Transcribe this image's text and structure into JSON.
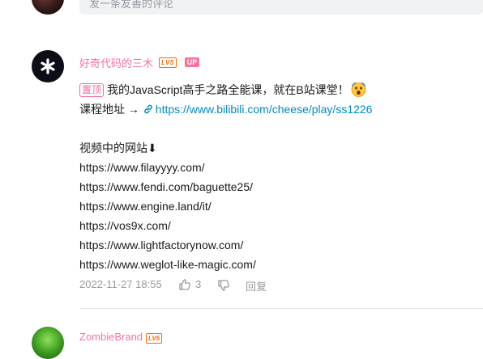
{
  "reply_box": {
    "placeholder": "发一条友善的评论"
  },
  "comment": {
    "username": "好奇代码的三木",
    "level_badge": "LV5",
    "up_badge": "UP",
    "pinned_label": "置顶",
    "line1_text": "我的JavaScript高手之路全能课，就在B站课堂！",
    "line2_label": "课程地址 →",
    "course_link": "https://www.bilibili.com/cheese/play/ss1226",
    "line3_text": "视频中的网站⬇",
    "sites": [
      "https://www.filayyyy.com/",
      "https://www.fendi.com/baguette25/",
      "https://www.engine.land/it/",
      "https://vos9x.com/",
      "https://www.lightfactorynow.com/",
      "https://www.weglot-like-magic.com/"
    ],
    "timestamp": "2022-11-27 18:55",
    "like_count": "3",
    "reply_label": "回复"
  },
  "next_comment": {
    "username": "ZombieBrand",
    "level_badge": "LV6"
  },
  "colors": {
    "username": "#fb7299",
    "link": "#008ac5",
    "meta": "#9499a0"
  }
}
